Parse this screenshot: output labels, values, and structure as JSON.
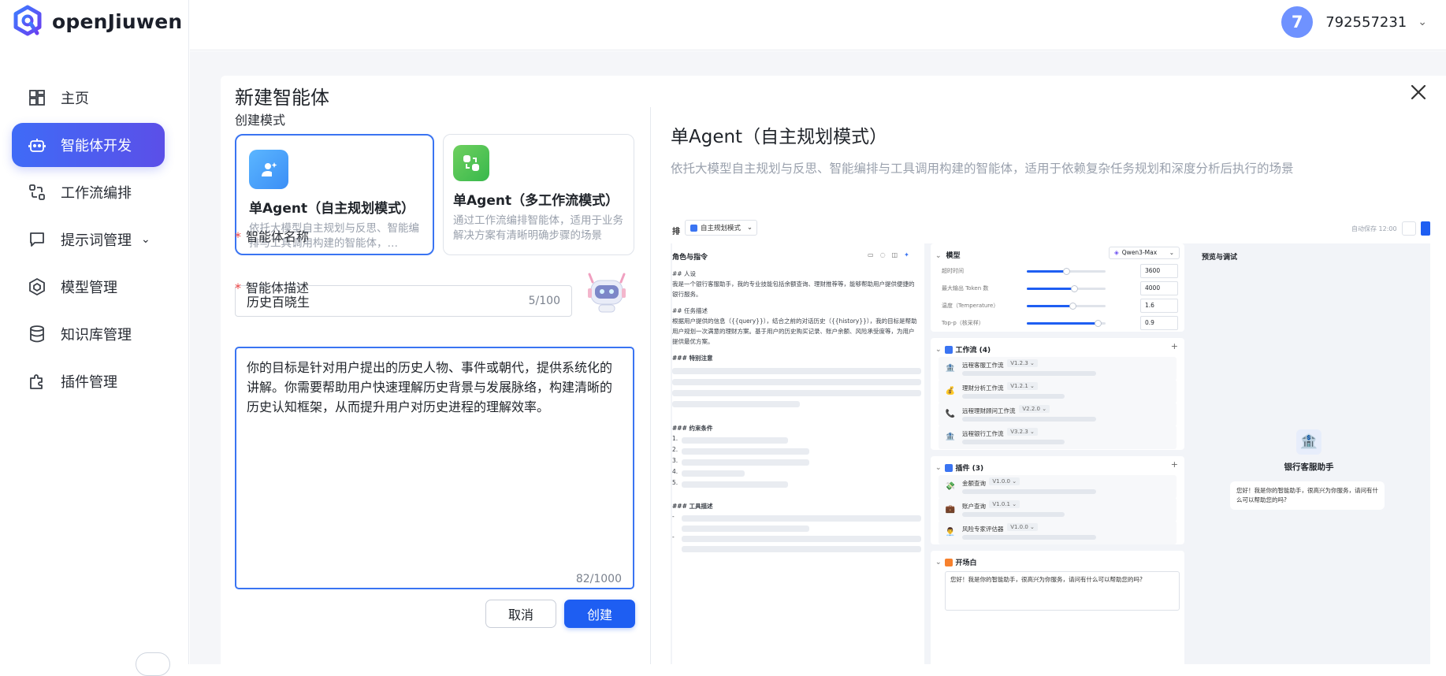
{
  "app": {
    "name": "openJiuwen"
  },
  "sidebar": {
    "items": [
      {
        "label": "主页",
        "icon": "dashboard-icon",
        "active": false
      },
      {
        "label": "智能体开发",
        "icon": "robot-icon",
        "active": true
      },
      {
        "label": "工作流编排",
        "icon": "workflow-icon",
        "active": false
      },
      {
        "label": "提示词管理",
        "icon": "chat-bubble-icon",
        "active": false,
        "has_chevron": true
      },
      {
        "label": "模型管理",
        "icon": "cube-icon",
        "active": false
      },
      {
        "label": "知识库管理",
        "icon": "database-icon",
        "active": false
      },
      {
        "label": "插件管理",
        "icon": "puzzle-icon",
        "active": false
      }
    ]
  },
  "user": {
    "avatar_letter": "7",
    "name": "792557231"
  },
  "modal": {
    "title": "新建智能体",
    "create_mode_label": "创建模式",
    "modes": [
      {
        "name": "单Agent（自主规划模式）",
        "desc": "依托大模型自主规划与反思、智能编排与工具调用构建的智能体，…",
        "selected": true
      },
      {
        "name": "单Agent（多工作流模式）",
        "desc": "通过工作流编排智能体，适用于业务解决方案有清晰明确步骤的场景",
        "selected": false
      }
    ],
    "name_label": "智能体名称",
    "name_value": "历史百晓生",
    "name_count": "5/100",
    "desc_label": "智能体描述",
    "desc_value": "你的目标是针对用户提出的历史人物、事件或朝代，提供系统化的讲解。你需要帮助用户快速理解历史背景与发展脉络，构建清晰的历史认知框架，从而提升用户对历史进程的理解效率。",
    "desc_count": "82/1000",
    "cancel_label": "取消",
    "create_label": "创建",
    "detail_title": "单Agent（自主规划模式）",
    "detail_subtitle": "依托大模型自主规划与反思、智能编排与工具调用构建的智能体，适用于依赖复杂任务规划和深度分析后执行的场景"
  },
  "preview": {
    "topbar": {
      "title": "排",
      "mode_select": "自主规划模式",
      "autosave": "自动保存 12:00"
    },
    "role": {
      "header": "角色与指令",
      "h_persona": "## 人设",
      "persona_text": "我是一个银行客服助手，我的专业技能包括余额查询、理财推荐等，能够帮助用户提供便捷的银行服务。",
      "h_task": "## 任务描述",
      "task_text": "根据用户提供的信息（{{query}}），结合之前的对话历史（{{history}}），我的目标是帮助用户规划一次满意的理财方案。基于用户的历史购买记录、账户余额、风险承受度等，为用户提供最优方案。",
      "h_notes": "### 特别注意",
      "h_constraints": "### 约束条件",
      "h_tools": "### 工具描述",
      "numbers": [
        "1.",
        "2.",
        "3.",
        "4.",
        "5."
      ],
      "dashes": [
        "-",
        "-"
      ]
    },
    "model": {
      "header": "模型",
      "select": "Qwen3-Max",
      "params": [
        {
          "label": "超时时间",
          "value": "3600",
          "level": 0.5
        },
        {
          "label": "最大输出 Token 数",
          "value": "4000",
          "level": 0.6
        },
        {
          "label": "温度（Temperature）",
          "value": "1.6",
          "level": 0.58
        },
        {
          "label": "Top-p（核采样）",
          "value": "0.9",
          "level": 0.9
        }
      ]
    },
    "workflows": {
      "header": "工作流 (4)",
      "items": [
        {
          "name": "远程客服工作流",
          "version": "V1.2.3",
          "icon": "🏦"
        },
        {
          "name": "理财分析工作流",
          "version": "V1.2.1",
          "icon": "💰"
        },
        {
          "name": "远程理财顾问工作流",
          "version": "V2.2.0",
          "icon": "📞"
        },
        {
          "name": "远程银行工作流",
          "version": "V3.2.3",
          "icon": "🏦"
        }
      ]
    },
    "plugins": {
      "header": "插件 (3)",
      "items": [
        {
          "name": "金额查询",
          "version": "V1.0.0",
          "icon": "💸"
        },
        {
          "name": "账户查询",
          "version": "V1.0.1",
          "icon": "💼"
        },
        {
          "name": "风险专家评估器",
          "version": "V1.0.0",
          "icon": "👨‍💼"
        }
      ]
    },
    "opening": {
      "header": "开场白",
      "text": "您好！我是你的智能助手，很高兴为你服务，请问有什么可以帮助您的吗?"
    },
    "debug": {
      "header": "预览与调试",
      "bot_name": "银行客服助手",
      "greeting": "您好！我是你的智能助手，很高兴为你服务，请问有什么可以帮助您的吗?"
    }
  }
}
